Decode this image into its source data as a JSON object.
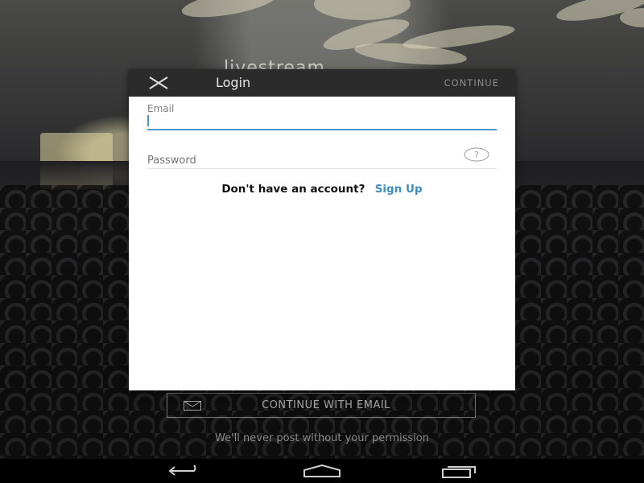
{
  "background": {
    "logo_text": "livestream",
    "cta_button": {
      "icon": "mail-icon",
      "label": "CONTINUE WITH EMAIL"
    },
    "permission_text": "We'll never post without your permission"
  },
  "dialog": {
    "title": "Login",
    "close_icon": "close-icon",
    "continue_label": "CONTINUE",
    "email": {
      "label": "Email",
      "value": ""
    },
    "password": {
      "placeholder": "Password",
      "help_icon": "help-question-icon"
    },
    "signup": {
      "prompt": "Don't have an account?",
      "link": "Sign Up"
    }
  },
  "navbar": {
    "back_icon": "back-icon",
    "home_icon": "home-icon",
    "recents_icon": "recent-apps-icon"
  },
  "colors": {
    "accent": "#3a8fc4",
    "header_bg": "#2b2b2b",
    "dialog_bg": "#ffffff"
  }
}
